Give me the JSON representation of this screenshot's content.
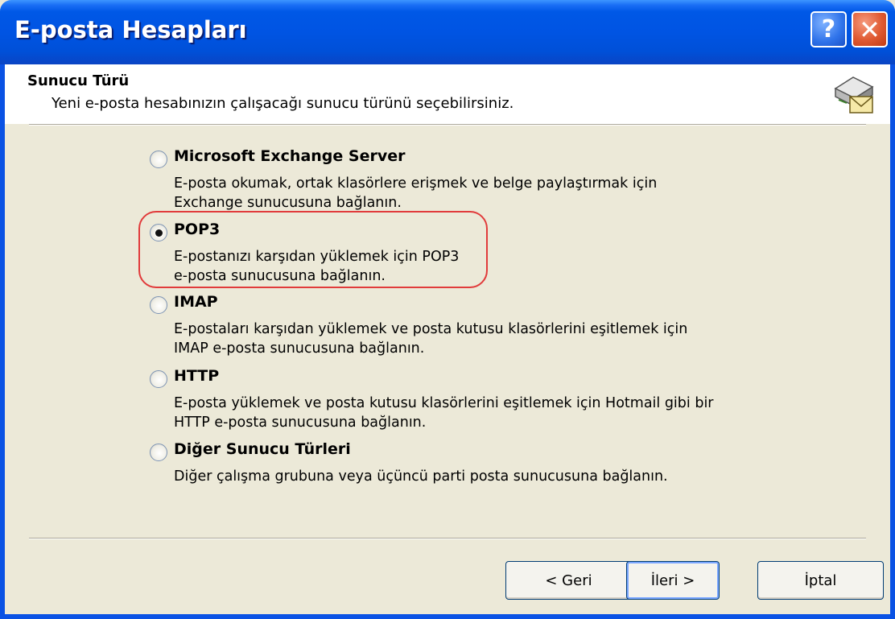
{
  "window": {
    "title": "E-posta Hesapları",
    "help_label": "?",
    "close_label": "✕"
  },
  "header": {
    "title": "Sunucu Türü",
    "subtitle": "Yeni e-posta hesabınızın çalışacağı sunucu türünü seçebilirsiniz.",
    "icon": "server-mail-icon"
  },
  "options": [
    {
      "title": "Microsoft Exchange Server",
      "desc_line1": "E-posta okumak, ortak klasörlere erişmek ve belge paylaştırmak için",
      "desc_line2": "Exchange sunucusuna bağlanın.",
      "checked": false
    },
    {
      "title": "POP3",
      "desc_line1": "E-postanızı karşıdan yüklemek için POP3",
      "desc_line2": "e-posta sunucusuna bağlanın.",
      "checked": true
    },
    {
      "title": "IMAP",
      "desc_line1": "E-postaları karşıdan yüklemek ve posta kutusu klasörlerini eşitlemek için",
      "desc_line2": "IMAP e-posta sunucusuna bağlanın.",
      "checked": false
    },
    {
      "title": "HTTP",
      "desc_line1": "E-posta yüklemek ve posta kutusu klasörlerini eşitlemek için Hotmail gibi bir",
      "desc_line2": "HTTP e-posta sunucusuna bağlanın.",
      "checked": false
    },
    {
      "title": "Diğer Sunucu Türleri",
      "desc_line1": "Diğer çalışma grubuna veya üçüncü parti posta sunucusuna bağlanın.",
      "desc_line2": "",
      "checked": false
    }
  ],
  "buttons": {
    "back": "< Geri",
    "next": "İleri >",
    "cancel": "İptal"
  },
  "colors": {
    "titlebar": "#0054e3",
    "highlight": "#e13b3b",
    "face": "#ece9d8"
  }
}
